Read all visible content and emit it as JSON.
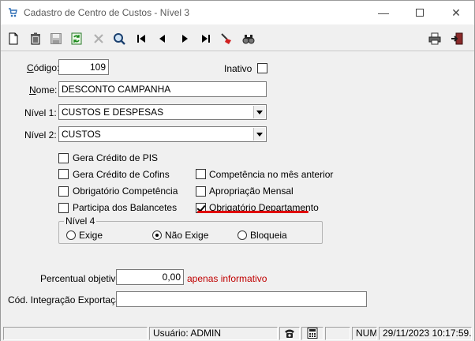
{
  "window": {
    "title": "Cadastro de Centro de Custos - Nível 3",
    "minimize": "—",
    "close": "✕"
  },
  "toolbar": {
    "icons": [
      "new-document-icon",
      "delete-icon",
      "save-icon",
      "refresh-icon",
      "cancel-icon",
      "search-icon",
      "first-record-icon",
      "previous-record-icon",
      "next-record-icon",
      "last-record-icon",
      "clear-filter-icon",
      "find-icon",
      "print-icon",
      "exit-icon"
    ]
  },
  "form": {
    "codigo_label": "Código:",
    "codigo_value": "109",
    "inativo_label": "Inativo",
    "nome_label": "Nome:",
    "nome_value": "DESCONTO CAMPANHA",
    "nivel1_label": "Nível 1:",
    "nivel1_value": "CUSTOS E DESPESAS",
    "nivel2_label": "Nível 2:",
    "nivel2_value": "CUSTOS",
    "checkboxes": [
      {
        "label": "Gera Crédito de PIS",
        "checked": false
      },
      {
        "label": "Gera Crédito de Cofins",
        "checked": false
      },
      {
        "label": "Obrigatório Competência",
        "checked": false
      },
      {
        "label": "Participa dos Balancetes",
        "checked": false
      },
      {
        "label": "Competência no mês anterior",
        "checked": false
      },
      {
        "label": "Apropriação Mensal",
        "checked": false
      },
      {
        "label": "Obrigatório Departamento",
        "checked": true
      }
    ],
    "nivel4": {
      "title": "Nível 4",
      "options": [
        "Exige",
        "Não Exige",
        "Bloqueia"
      ],
      "selected": "Não Exige"
    },
    "percentual_label": "Percentual objetivo:",
    "percentual_value": "0,00",
    "percentual_note": "apenas informativo",
    "integracao_label": "Cód. Integração Exportação:",
    "integracao_value": ""
  },
  "statusbar": {
    "user": "Usuário: ADMIN",
    "num": "NUM",
    "datetime": "29/11/2023 10:17:59..."
  },
  "colors": {
    "accent_red": "#e00000",
    "note_red": "#c00000",
    "window_bg": "#f0f0f0"
  }
}
